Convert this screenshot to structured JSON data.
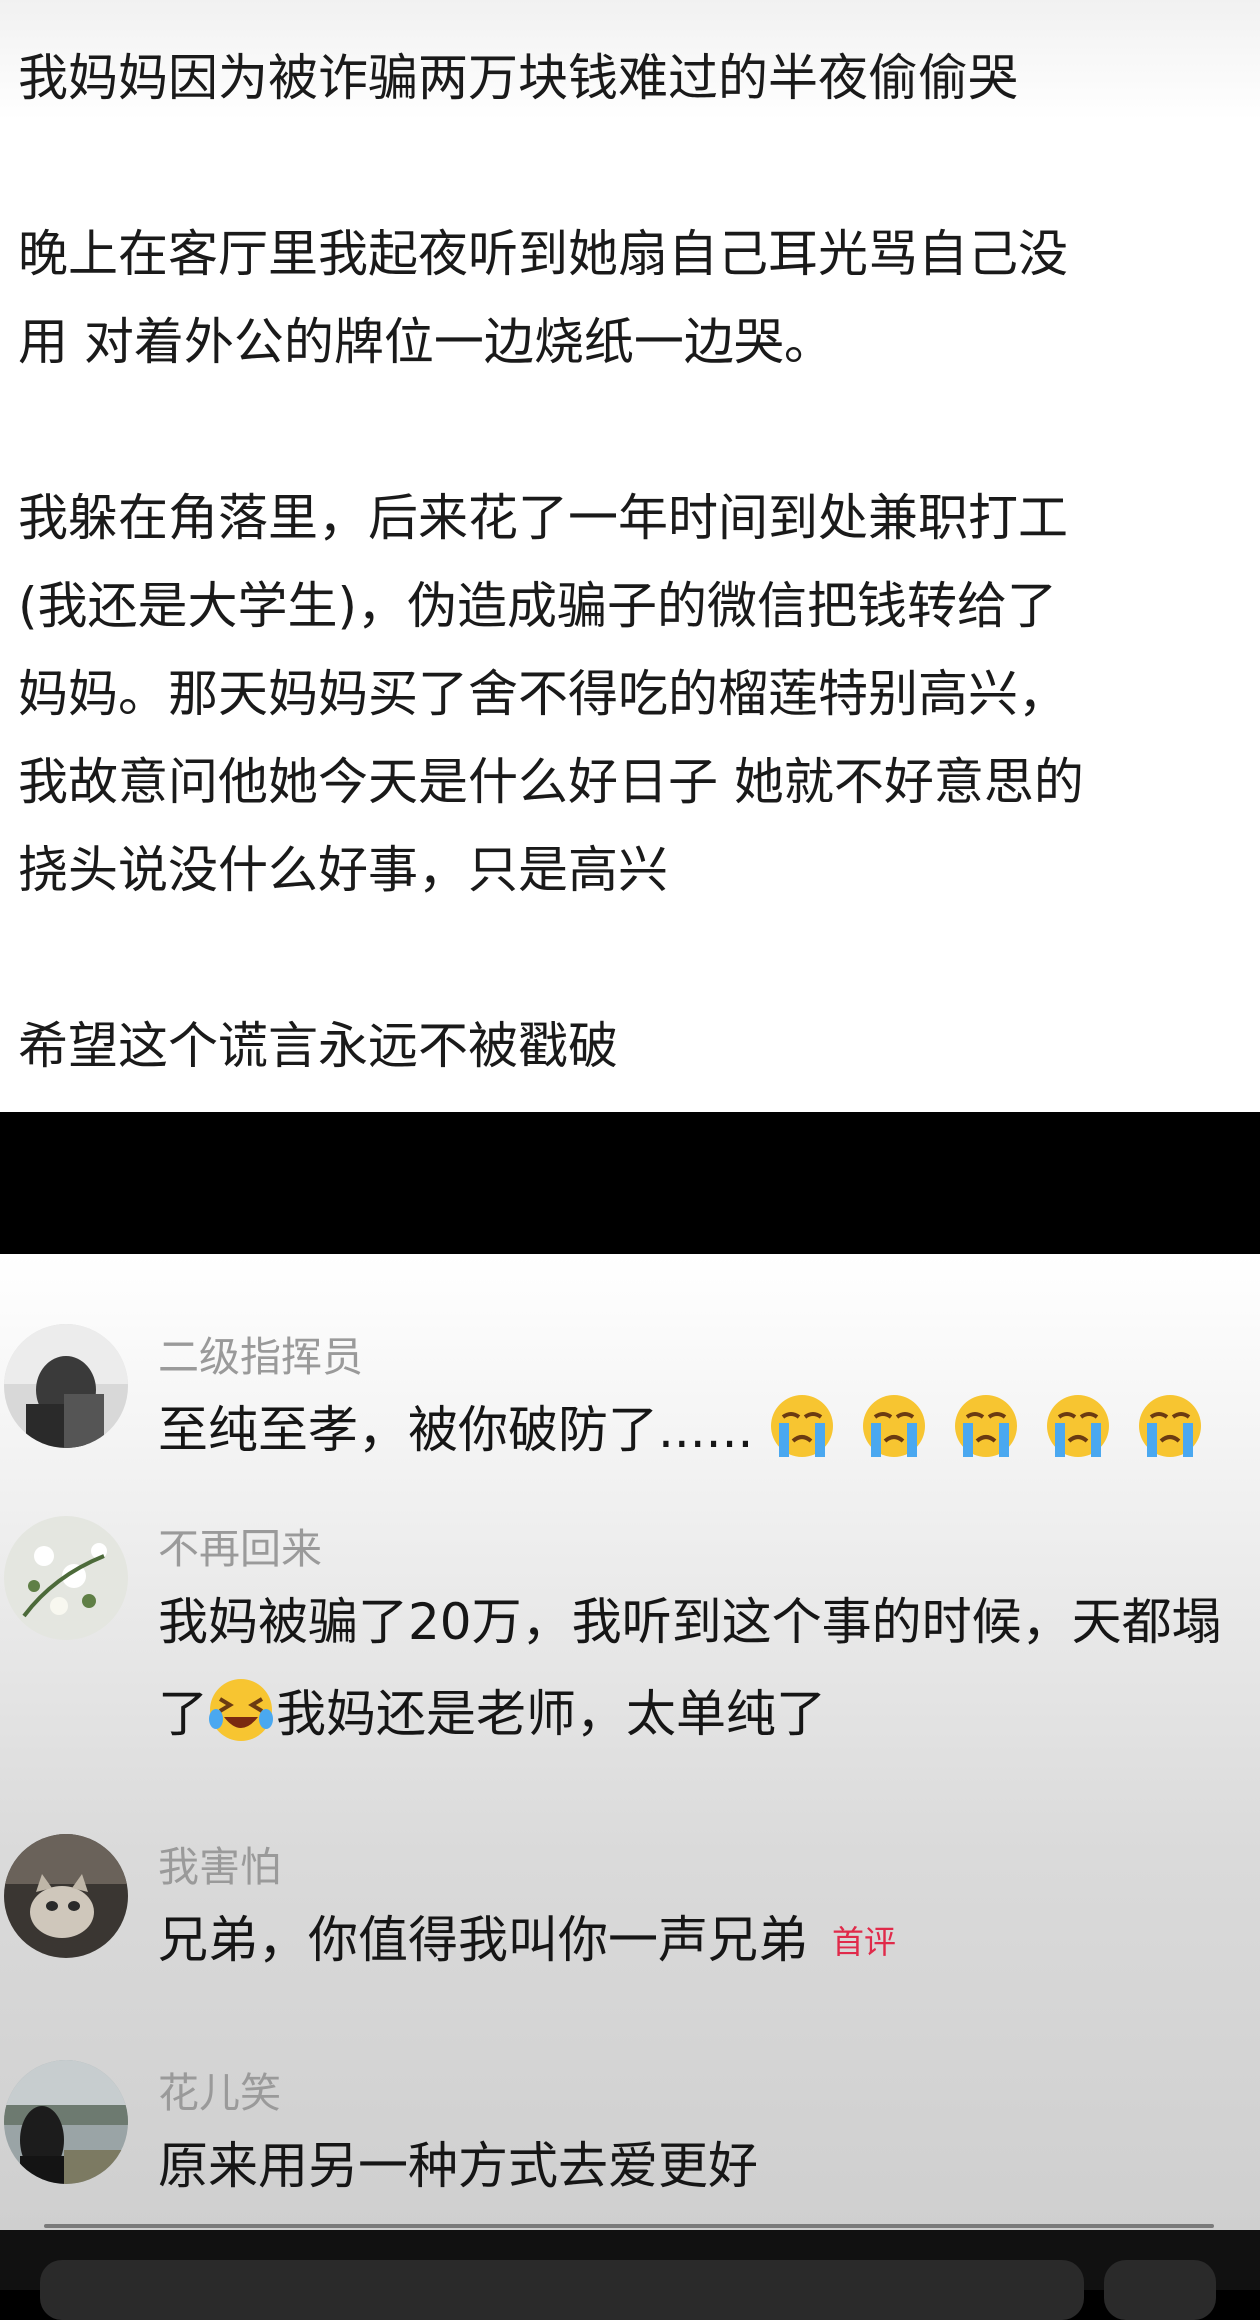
{
  "post": {
    "lines": [
      "我妈妈因为被诈骗两万块钱难过的半夜偷偷哭",
      "",
      "晚上在客厅里我起夜听到她扇自己耳光骂自己没",
      "用 对着外公的牌位一边烧纸一边哭。",
      "",
      "我躲在角落里，后来花了一年时间到处兼职打工",
      "(我还是大学生)，伪造成骗子的微信把钱转给了",
      "妈妈。那天妈妈买了舍不得吃的榴莲特别高兴，",
      "我故意问他她今天是什么好日子 她就不好意思的",
      "挠头说没什么好事，只是高兴",
      "",
      "希望这个谎言永远不被戳破"
    ]
  },
  "comments": [
    {
      "username": "二级指挥员",
      "text": "至纯至孝，被你破防了......",
      "emoji": "crying-face-emoji"
    },
    {
      "username": "不再回来",
      "line1": "我妈被骗了20万，我听到这个事的时候，天都塌",
      "line2_prefix": "了",
      "emoji": "laughing-tears-emoji",
      "line2_suffix": "我妈还是老师，太单纯了"
    },
    {
      "username": "我害怕",
      "text": "兄弟，你值得我叫你一声兄弟",
      "badge": "首评"
    },
    {
      "username": "花儿笑",
      "text": "原来用另一种方式去爱更好"
    }
  ],
  "colors": {
    "badge": "#e02a4a",
    "username": "#9a9a9a"
  }
}
